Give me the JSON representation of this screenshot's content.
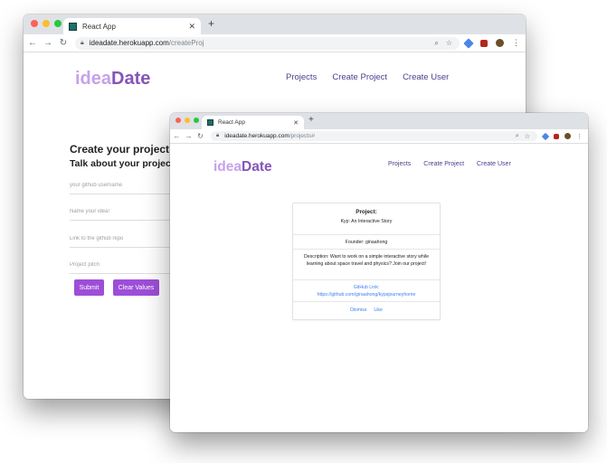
{
  "colors": {
    "accent": "#9d4ed8",
    "logo_light": "#c6a2ea",
    "logo_dark": "#8455ba",
    "nav": "#4b3f8a",
    "link": "#3b7ff0"
  },
  "back_window": {
    "tab_title": "React App",
    "url_host": "ideadate.herokuapp.com",
    "url_path": "/createProj",
    "logo_part1": "idea",
    "logo_part2": "Date",
    "nav": [
      "Projects",
      "Create Project",
      "Create User"
    ],
    "form": {
      "heading": "Create your project p",
      "subheading": "Talk about your project a",
      "fields": [
        {
          "placeholder": "your github username"
        },
        {
          "placeholder": "Name your idea!"
        },
        {
          "placeholder": "Link to the github repo"
        },
        {
          "placeholder": "Project pitch"
        }
      ],
      "submit_label": "Submit",
      "clear_label": "Clear Values"
    }
  },
  "front_window": {
    "tab_title": "React App",
    "url_host": "ideadate.herokuapp.com",
    "url_path": "/projects#",
    "logo_part1": "idea",
    "logo_part2": "Date",
    "nav": [
      "Projects",
      "Create Project",
      "Create User"
    ],
    "card": {
      "title": "Project:",
      "name": "Kyp: An Interactive Story",
      "founder": "Founder: ginaahong",
      "description": "Description: Want to work on a simple interactive story while learning about space travel and physics? Join our project!",
      "github_label": "GitHub Link:",
      "github_url": "https://github.com/ginaahong/kypsjourneyhome",
      "dismiss_label": "Dismiss",
      "like_label": "Like"
    }
  }
}
